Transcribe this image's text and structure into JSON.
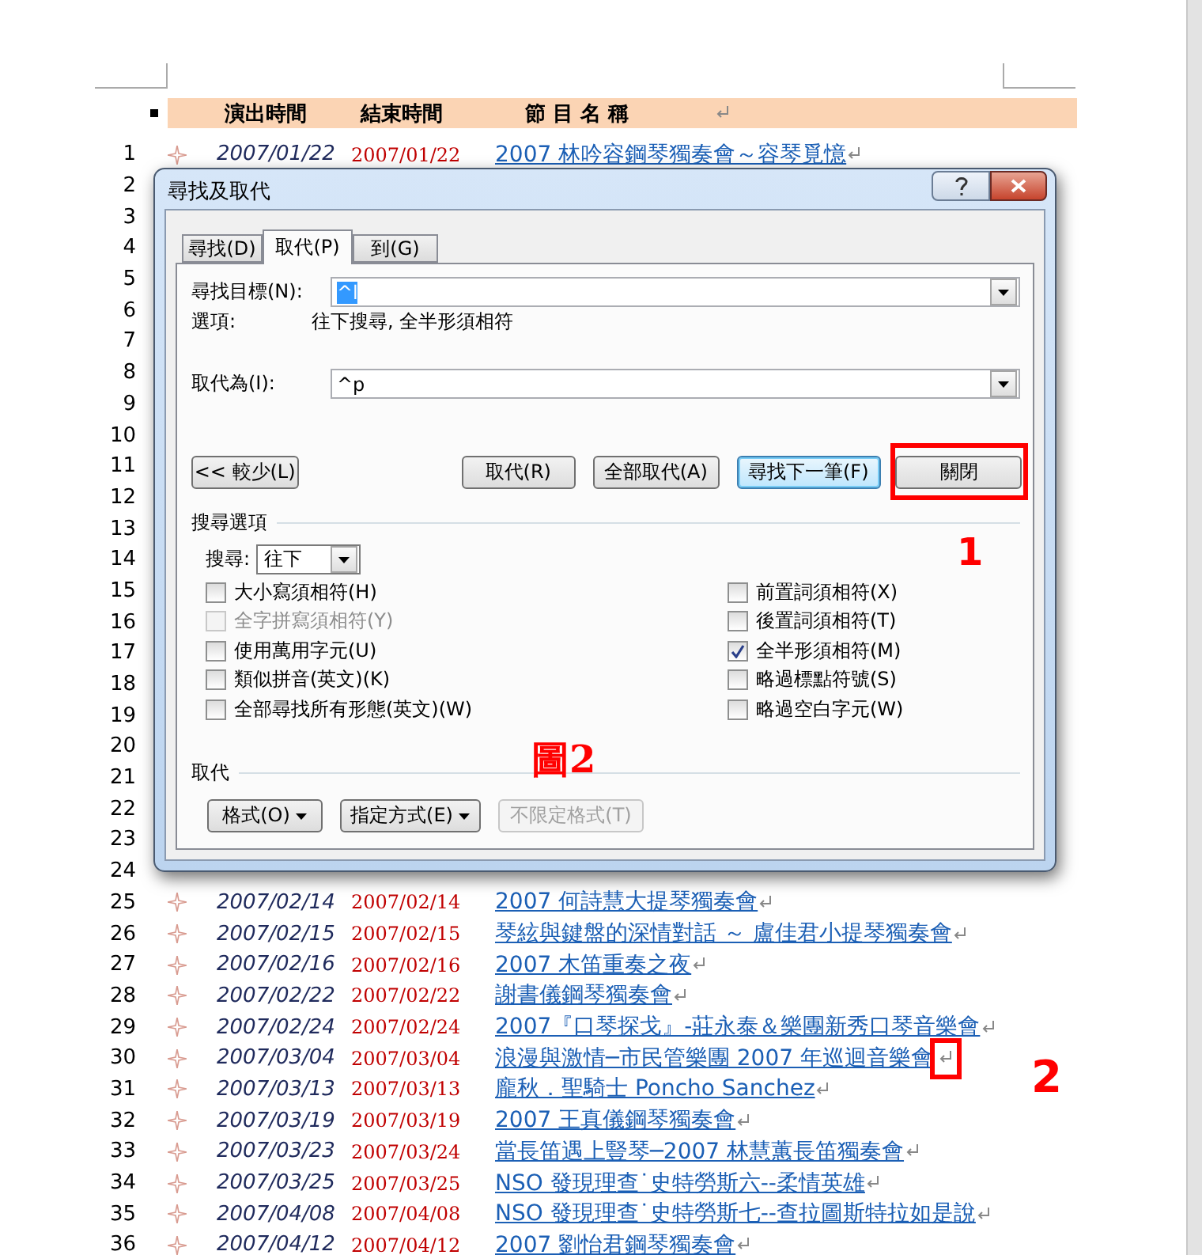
{
  "document": {
    "header": [
      "演出時間",
      "結束時間",
      "節 目 名 稱"
    ],
    "rows": [
      {
        "num": "1",
        "start": "2007/01/22",
        "end": "2007/01/22",
        "title": "2007 林吟容鋼琴獨奏會～容琴覓憶"
      },
      {
        "num": "2"
      },
      {
        "num": "3"
      },
      {
        "num": "4"
      },
      {
        "num": "5"
      },
      {
        "num": "6"
      },
      {
        "num": "7"
      },
      {
        "num": "8"
      },
      {
        "num": "9"
      },
      {
        "num": "10"
      },
      {
        "num": "11"
      },
      {
        "num": "12"
      },
      {
        "num": "13"
      },
      {
        "num": "14"
      },
      {
        "num": "15"
      },
      {
        "num": "16"
      },
      {
        "num": "17"
      },
      {
        "num": "18"
      },
      {
        "num": "19"
      },
      {
        "num": "20"
      },
      {
        "num": "21"
      },
      {
        "num": "22"
      },
      {
        "num": "23"
      },
      {
        "num": "24"
      },
      {
        "num": "25",
        "start": "2007/02/14",
        "end": "2007/02/14",
        "title": "2007 何詩慧大提琴獨奏會"
      },
      {
        "num": "26",
        "start": "2007/02/15",
        "end": "2007/02/15",
        "title": "琴絃與鍵盤的深情對話 ～ 盧佳君小提琴獨奏會"
      },
      {
        "num": "27",
        "start": "2007/02/16",
        "end": "2007/02/16",
        "title": "2007 木笛重奏之夜"
      },
      {
        "num": "28",
        "start": "2007/02/22",
        "end": "2007/02/22",
        "title": "謝書儀鋼琴獨奏會"
      },
      {
        "num": "29",
        "start": "2007/02/24",
        "end": "2007/02/24",
        "title": "2007『口琴探戈』-莊永泰＆樂團新秀口琴音樂會"
      },
      {
        "num": "30",
        "start": "2007/03/04",
        "end": "2007/03/04",
        "title": "浪漫與激情─市民管樂團 2007 年巡迴音樂會",
        "boxed": true
      },
      {
        "num": "31",
        "start": "2007/03/13",
        "end": "2007/03/13",
        "title": "龐秋．聖騎士 Poncho Sanchez"
      },
      {
        "num": "32",
        "start": "2007/03/19",
        "end": "2007/03/19",
        "title": "2007 王真儀鋼琴獨奏會"
      },
      {
        "num": "33",
        "start": "2007/03/23",
        "end": "2007/03/24",
        "title": "當長笛遇上豎琴─2007 林慧蕙長笛獨奏會"
      },
      {
        "num": "34",
        "start": "2007/03/25",
        "end": "2007/03/25",
        "title": "NSO 發現理查˙史特勞斯六--柔情英雄"
      },
      {
        "num": "35",
        "start": "2007/04/08",
        "end": "2007/04/08",
        "title": "NSO 發現理查˙史特勞斯七--查拉圖斯特拉如是說"
      },
      {
        "num": "36",
        "start": "2007/04/12",
        "end": "2007/04/12",
        "title": "2007 劉怡君鋼琴獨奏會"
      }
    ]
  },
  "dialog": {
    "title": "尋找及取代",
    "tabs": [
      {
        "label": "尋找(D)",
        "selected": false
      },
      {
        "label": "取代(P)",
        "selected": true
      },
      {
        "label": "到(G)",
        "selected": false
      }
    ],
    "find": {
      "label": "尋找目標(N):",
      "value": "^l"
    },
    "options": {
      "label": "選項:",
      "value": "往下搜尋, 全半形須相符"
    },
    "replace": {
      "label": "取代為(I):",
      "value": "^p"
    },
    "less_button": "<< 較少(L)",
    "buttons": [
      {
        "label": "取代(R)",
        "default": false,
        "boxed": false
      },
      {
        "label": "全部取代(A)",
        "default": false,
        "boxed": false
      },
      {
        "label": "尋找下一筆(F)",
        "default": true,
        "boxed": false
      },
      {
        "label": "關閉",
        "default": false,
        "boxed": true
      }
    ],
    "search_options": {
      "title": "搜尋選項",
      "direction_label": "搜尋:",
      "direction": "往下",
      "left": [
        {
          "label": "大小寫須相符(H)",
          "checked": false,
          "disabled": false
        },
        {
          "label": "全字拼寫須相符(Y)",
          "checked": false,
          "disabled": true
        },
        {
          "label": "使用萬用字元(U)",
          "checked": false,
          "disabled": false
        },
        {
          "label": "類似拼音(英文)(K)",
          "checked": false,
          "disabled": false
        },
        {
          "label": "全部尋找所有形態(英文)(W)",
          "checked": false,
          "disabled": false
        }
      ],
      "right": [
        {
          "label": "前置詞須相符(X)",
          "checked": false,
          "disabled": false
        },
        {
          "label": "後置詞須相符(T)",
          "checked": false,
          "disabled": false
        },
        {
          "label": "全半形須相符(M)",
          "checked": true,
          "disabled": false
        },
        {
          "label": "略過標點符號(S)",
          "checked": false,
          "disabled": false
        },
        {
          "label": "略過空白字元(W)",
          "checked": false,
          "disabled": false
        }
      ]
    },
    "replace_section": {
      "title": "取代",
      "buttons": [
        {
          "label": "格式(O)",
          "dropdown": true,
          "disabled": false
        },
        {
          "label": "指定方式(E)",
          "dropdown": true,
          "disabled": false
        },
        {
          "label": "不限定格式(T)",
          "dropdown": false,
          "disabled": true
        }
      ]
    }
  },
  "annotations": {
    "close_label": "1",
    "figure_label": "圖2",
    "mark_label": "2"
  }
}
